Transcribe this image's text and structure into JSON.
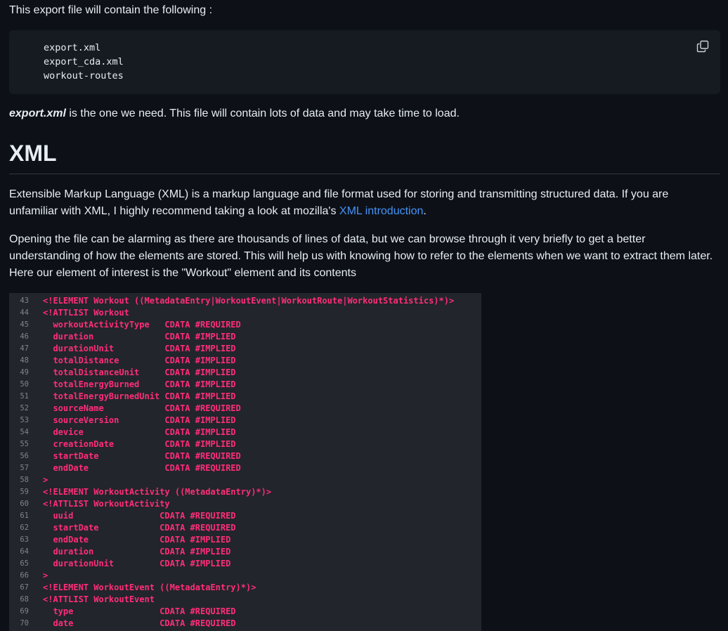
{
  "intro_text": "This export file will contain the following :",
  "file_list": [
    "export.xml",
    "export_cda.xml",
    "workout-routes"
  ],
  "copy_icon": "copy-icon",
  "note": {
    "emphasis": "export.xml",
    "rest": " is the one we need. This file will contain lots of data and may take time to load."
  },
  "heading": "XML",
  "para1": {
    "before": "Extensible Markup Language (XML) is a markup language and file format used for storing and transmitting structured data. If you are unfamiliar with XML, I highly recommend taking a look at mozilla's ",
    "link": "XML introduction",
    "after": "."
  },
  "para2": "Opening the file can be alarming as there are thousands of lines of data, but we can browse through it very briefly to get a better understanding of how the elements are stored. This will help us with knowing how to refer to the elements when we want to extract them later. Here our element of interest is the \"Workout\" element and its contents",
  "code_lines": [
    {
      "n": "43",
      "t": "<!ELEMENT Workout ((MetadataEntry|WorkoutEvent|WorkoutRoute|WorkoutStatistics)*)>"
    },
    {
      "n": "44",
      "t": "<!ATTLIST Workout"
    },
    {
      "n": "45",
      "t": "  workoutActivityType   CDATA #REQUIRED"
    },
    {
      "n": "46",
      "t": "  duration              CDATA #IMPLIED"
    },
    {
      "n": "47",
      "t": "  durationUnit          CDATA #IMPLIED"
    },
    {
      "n": "48",
      "t": "  totalDistance         CDATA #IMPLIED"
    },
    {
      "n": "49",
      "t": "  totalDistanceUnit     CDATA #IMPLIED"
    },
    {
      "n": "50",
      "t": "  totalEnergyBurned     CDATA #IMPLIED"
    },
    {
      "n": "51",
      "t": "  totalEnergyBurnedUnit CDATA #IMPLIED"
    },
    {
      "n": "52",
      "t": "  sourceName            CDATA #REQUIRED"
    },
    {
      "n": "53",
      "t": "  sourceVersion         CDATA #IMPLIED"
    },
    {
      "n": "54",
      "t": "  device                CDATA #IMPLIED"
    },
    {
      "n": "55",
      "t": "  creationDate          CDATA #IMPLIED"
    },
    {
      "n": "56",
      "t": "  startDate             CDATA #REQUIRED"
    },
    {
      "n": "57",
      "t": "  endDate               CDATA #REQUIRED"
    },
    {
      "n": "58",
      "t": ">"
    },
    {
      "n": "59",
      "t": "<!ELEMENT WorkoutActivity ((MetadataEntry)*)>"
    },
    {
      "n": "60",
      "t": "<!ATTLIST WorkoutActivity"
    },
    {
      "n": "61",
      "t": "  uuid                 CDATA #REQUIRED"
    },
    {
      "n": "62",
      "t": "  startDate            CDATA #REQUIRED"
    },
    {
      "n": "63",
      "t": "  endDate              CDATA #IMPLIED"
    },
    {
      "n": "64",
      "t": "  duration             CDATA #IMPLIED"
    },
    {
      "n": "65",
      "t": "  durationUnit         CDATA #IMPLIED"
    },
    {
      "n": "66",
      "t": ">"
    },
    {
      "n": "67",
      "t": "<!ELEMENT WorkoutEvent ((MetadataEntry)*)>"
    },
    {
      "n": "68",
      "t": "<!ATTLIST WorkoutEvent"
    },
    {
      "n": "69",
      "t": "  type                 CDATA #REQUIRED"
    },
    {
      "n": "70",
      "t": "  date                 CDATA #REQUIRED"
    }
  ]
}
